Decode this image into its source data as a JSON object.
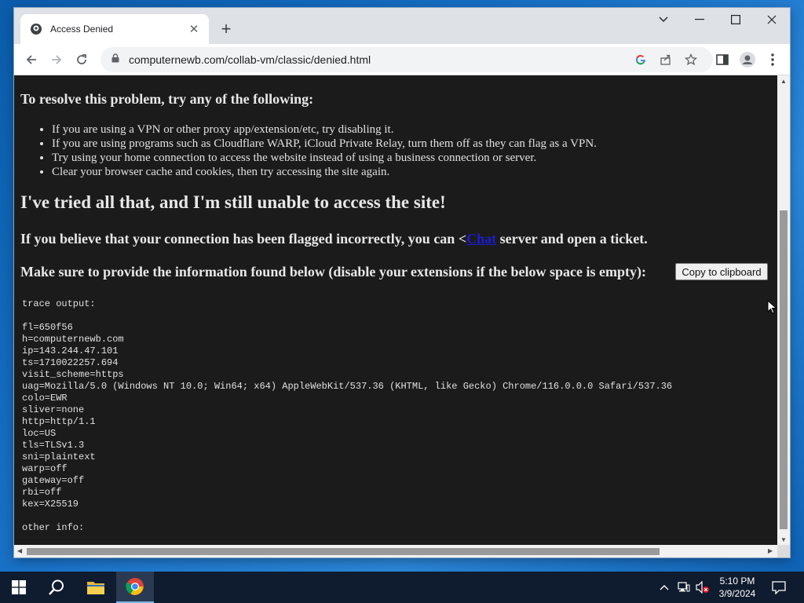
{
  "browser": {
    "tab_title": "Access Denied",
    "url": "computernewb.com/collab-vm/classic/denied.html"
  },
  "page": {
    "resolve_heading": "To resolve this problem, try any of the following:",
    "tips": [
      "If you are using a VPN or other proxy app/extension/etc, try disabling it.",
      "If you are using programs such as Cloudflare WARP, iCloud Private Relay, turn them off as they can flag as a VPN.",
      "Try using your home connection to access the website instead of using a business connection or server.",
      "Clear your browser cache and cookies, then try accessing the site again."
    ],
    "tried_heading": "I've tried all that, and I'm still unable to access the site!",
    "flag_prefix": "If you believe that your connection has been flagged incorrectly, you can <",
    "flag_link": "Chat",
    "flag_suffix": " server and open a ticket.",
    "provide_heading": "Make sure to provide the information found below (disable your extensions if the below space is empty):",
    "copy_button": "Copy to clipboard",
    "trace_title": "trace output:",
    "trace_lines": [
      "fl=650f56",
      "h=computernewb.com",
      "ip=143.244.47.101",
      "ts=1710022257.694",
      "visit_scheme=https",
      "uag=Mozilla/5.0 (Windows NT 10.0; Win64; x64) AppleWebKit/537.36 (KHTML, like Gecko) Chrome/116.0.0.0 Safari/537.36",
      "colo=EWR",
      "sliver=none",
      "http=http/1.1",
      "loc=US",
      "tls=TLSv1.3",
      "sni=plaintext",
      "warp=off",
      "gateway=off",
      "rbi=off",
      "kex=X25519"
    ],
    "other_info": "other info:"
  },
  "taskbar": {
    "time": "5:10 PM",
    "date": "3/9/2024"
  },
  "colors": {
    "page_bg": "#1b1b1b",
    "link": "#1c1cd6",
    "taskbar": "#0f1b2e"
  }
}
